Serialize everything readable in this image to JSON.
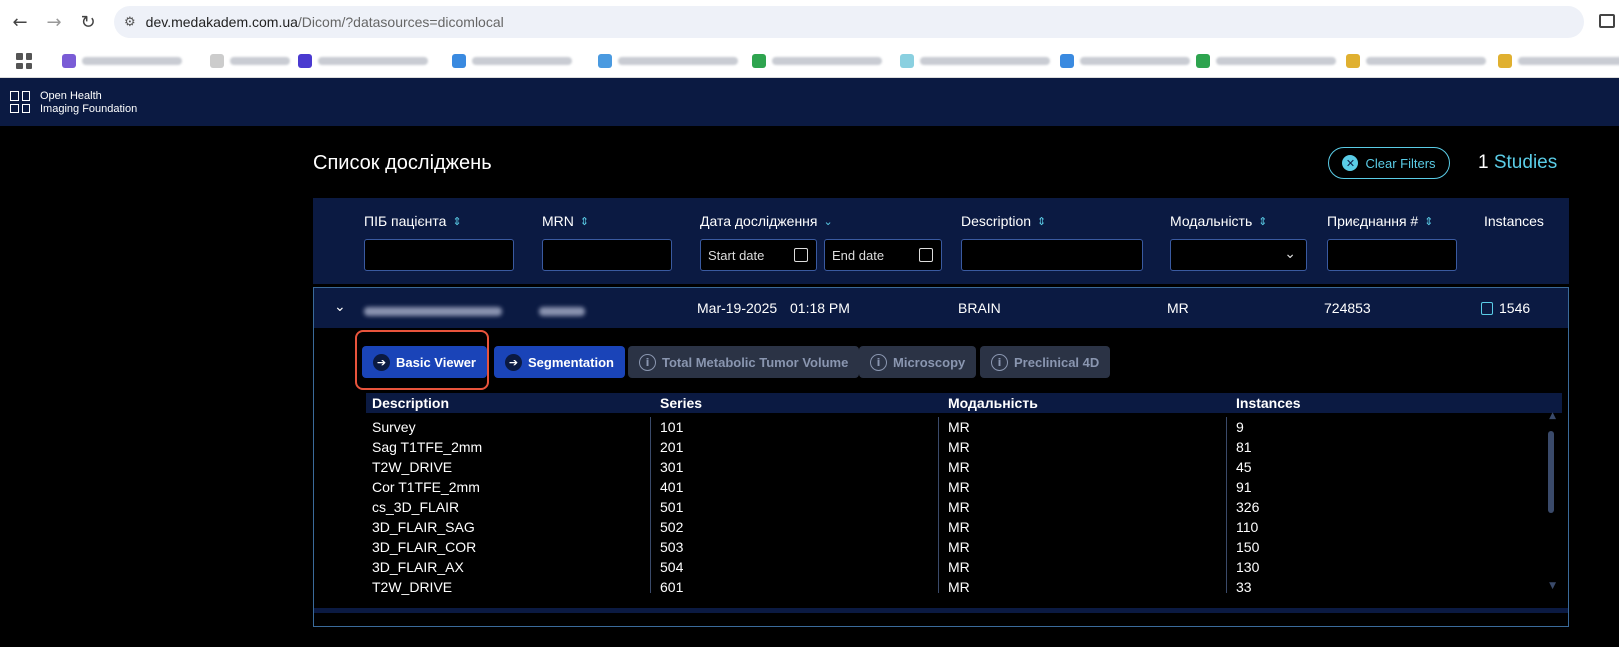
{
  "browser": {
    "url_host": "dev.medakadem.com.ua",
    "url_path": "/Dicom/?datasources=dicomlocal"
  },
  "header": {
    "logo_line1": "Open Health",
    "logo_line2": "Imaging Foundation"
  },
  "page": {
    "title": "Список досліджень",
    "clear_filters": "Clear Filters",
    "study_count": "1",
    "studies_label": "Studies"
  },
  "filters": {
    "columns": [
      "ПІБ пацієнта",
      "MRN",
      "Дата дослідження",
      "Description",
      "Модальність",
      "Приєднання #",
      "Instances"
    ],
    "start_date_placeholder": "Start date",
    "end_date_placeholder": "End date"
  },
  "study": {
    "date": "Mar-19-2025",
    "time": "01:18 PM",
    "description": "BRAIN",
    "modality": "MR",
    "accession": "724853",
    "instances": "1546"
  },
  "modes": [
    {
      "label": "Basic Viewer",
      "enabled": true
    },
    {
      "label": "Segmentation",
      "enabled": true
    },
    {
      "label": "Total Metabolic Tumor Volume",
      "enabled": false
    },
    {
      "label": "Microscopy",
      "enabled": false
    },
    {
      "label": "Preclinical 4D",
      "enabled": false
    }
  ],
  "series_table": {
    "headers": [
      "Description",
      "Series",
      "Модальність",
      "Instances"
    ],
    "rows": [
      [
        "Survey",
        "101",
        "MR",
        "9"
      ],
      [
        "Sag T1TFE_2mm",
        "201",
        "MR",
        "81"
      ],
      [
        "T2W_DRIVE",
        "301",
        "MR",
        "45"
      ],
      [
        "Cor T1TFE_2mm",
        "401",
        "MR",
        "91"
      ],
      [
        "cs_3D_FLAIR",
        "501",
        "MR",
        "326"
      ],
      [
        "3D_FLAIR_SAG",
        "502",
        "MR",
        "110"
      ],
      [
        "3D_FLAIR_COR",
        "503",
        "MR",
        "150"
      ],
      [
        "3D_FLAIR_AX",
        "504",
        "MR",
        "130"
      ],
      [
        "T2W_DRIVE",
        "601",
        "MR",
        "33"
      ]
    ]
  },
  "colors": {
    "accent": "#5acce6",
    "primary_button": "#1a44b8",
    "header_bg": "#0b1a42",
    "highlight": "#e8543c"
  }
}
